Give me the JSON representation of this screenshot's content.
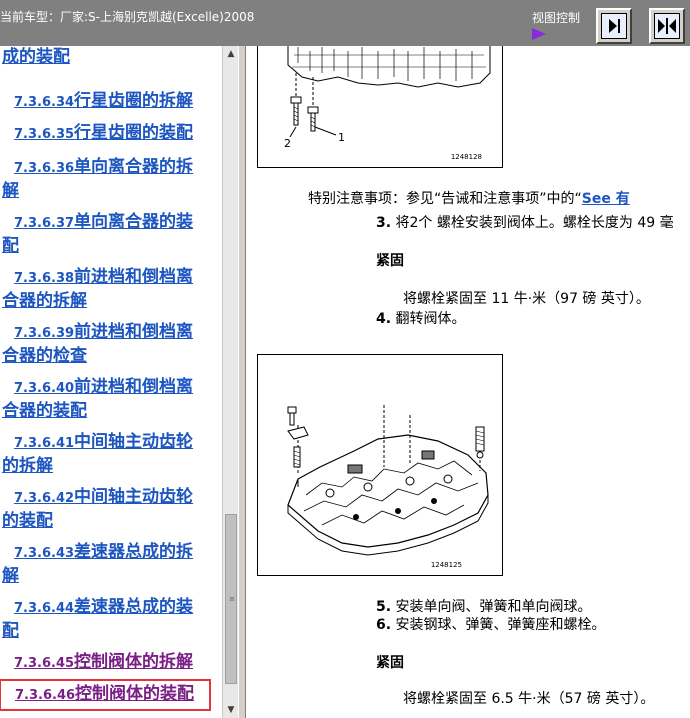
{
  "titlebar": {
    "model_label": "当前车型：厂家:S-上海别克凯越(Excelle)2008",
    "view_control_label": "视图控制"
  },
  "toc": {
    "items": [
      {
        "num": "",
        "title": "成的装配",
        "state": "normal"
      },
      {
        "num": "7.3.6.34",
        "title": "行星齿圈的拆解",
        "state": "normal"
      },
      {
        "num": "7.3.6.35",
        "title": "行星齿圈的装配",
        "state": "normal"
      },
      {
        "num": "7.3.6.36",
        "title": "单向离合器的拆",
        "cont": "解",
        "state": "normal"
      },
      {
        "num": "7.3.6.37",
        "title": "单向离合器的装",
        "cont": "配",
        "state": "normal"
      },
      {
        "num": "7.3.6.38",
        "title": "前进档和倒档离",
        "cont": "合器的拆解",
        "state": "normal"
      },
      {
        "num": "7.3.6.39",
        "title": "前进档和倒档离",
        "cont": "合器的检查",
        "state": "normal"
      },
      {
        "num": "7.3.6.40",
        "title": "前进档和倒档离",
        "cont": "合器的装配",
        "state": "normal"
      },
      {
        "num": "7.3.6.41",
        "title": "中间轴主动齿轮",
        "cont": "的拆解",
        "state": "normal"
      },
      {
        "num": "7.3.6.42",
        "title": "中间轴主动齿轮",
        "cont": "的装配",
        "state": "normal"
      },
      {
        "num": "7.3.6.43",
        "title": "差速器总成的拆",
        "cont": "解",
        "state": "normal"
      },
      {
        "num": "7.3.6.44",
        "title": "差速器总成的装",
        "cont": "配",
        "state": "normal"
      },
      {
        "num": "7.3.6.45",
        "title": "控制阀体的拆解",
        "state": "visited"
      },
      {
        "num": "7.3.6.46",
        "title": "控制阀体的装配",
        "state": "selected"
      }
    ]
  },
  "content": {
    "figure1": {
      "id": "1248128",
      "callout1": "1",
      "callout2": "2"
    },
    "notice": "特别注意事项：参见“告诫和注意事项”中的“",
    "notice_link": "See 有",
    "step3_num": "3.",
    "step3": "将2个 螺栓安装到阀体上。螺栓长度为 49 毫",
    "tighten1_head": "紧固",
    "tighten1": "将螺栓紧固至 11 牛·米（97 磅 英寸）。",
    "step4_num": "4.",
    "step4": "翻转阀体。",
    "figure2": {
      "id": "1248125"
    },
    "step5_num": "5.",
    "step5": "安装单向阀、弹簧和单向阀球。",
    "step6_num": "6.",
    "step6": "安装钢球、弹簧、弹簧座和螺栓。",
    "tighten2_head": "紧固",
    "tighten2": "将螺栓紧固至 6.5 牛·米（57 磅 英寸）。"
  },
  "colors": {
    "titlebar_bg": "#808080",
    "link": "#1d56c0",
    "visited": "#7a1f86",
    "selected_outline": "#e8333a"
  }
}
